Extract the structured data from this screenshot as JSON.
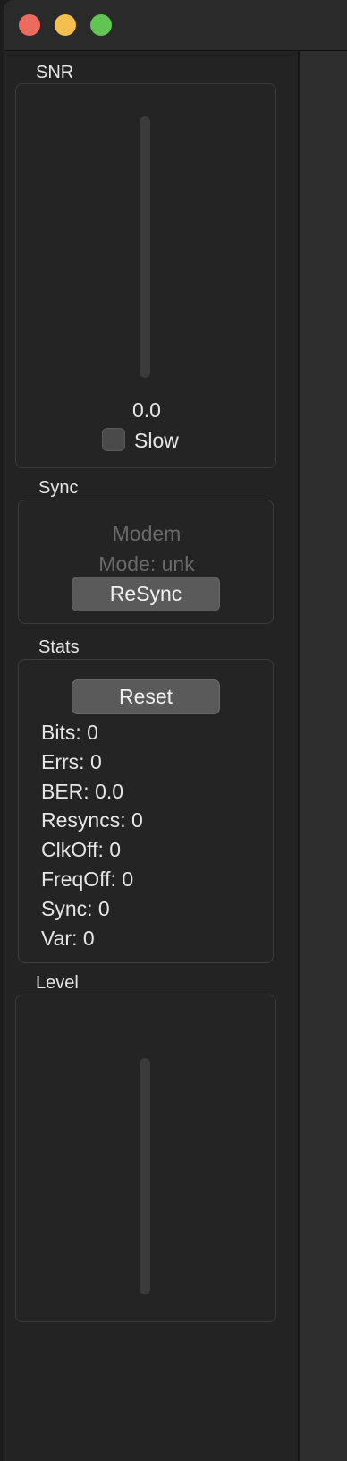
{
  "snr": {
    "title": "SNR",
    "value": "0.0",
    "slow_label": "Slow",
    "slow_checked": false
  },
  "sync": {
    "title": "Sync",
    "modem_line1": "Modem",
    "modem_line2": "Mode: unk",
    "resync_label": "ReSync"
  },
  "stats": {
    "title": "Stats",
    "reset_label": "Reset",
    "items": [
      "Bits: 0",
      "Errs: 0",
      "BER: 0.0",
      "Resyncs: 0",
      "ClkOff: 0",
      "FreqOff: 0",
      "Sync: 0",
      "Var: 0"
    ]
  },
  "level": {
    "title": "Level"
  },
  "colors": {
    "close": "#ec6a5e",
    "minimize": "#f4bf4f",
    "maximize": "#61c554"
  }
}
